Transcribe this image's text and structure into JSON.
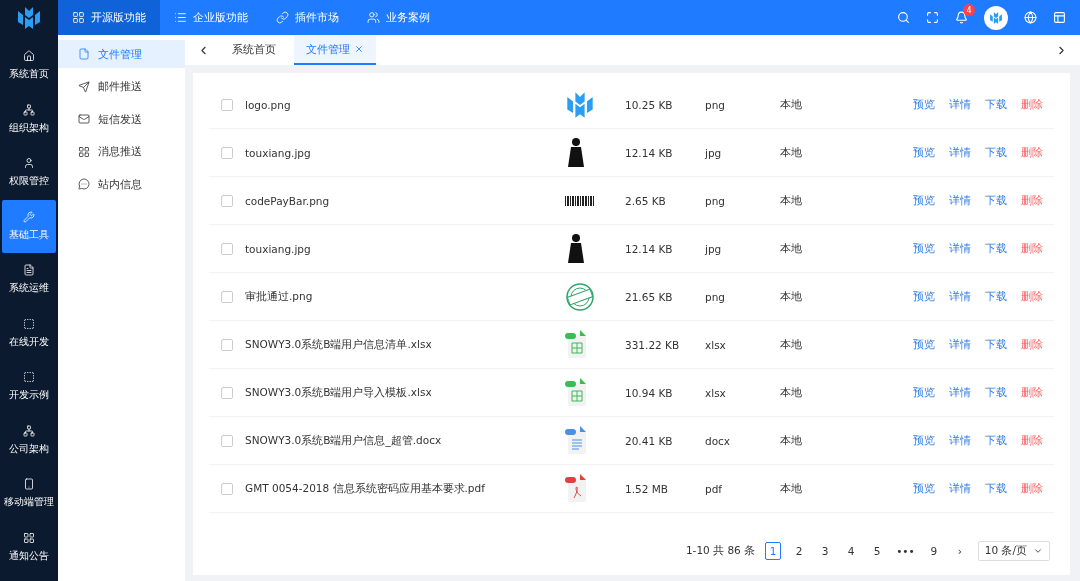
{
  "top_menu": [
    {
      "label": "开源版功能",
      "selected": true
    },
    {
      "label": "企业版功能",
      "selected": false
    },
    {
      "label": "插件市场",
      "selected": false
    },
    {
      "label": "业务案例",
      "selected": false
    }
  ],
  "notifications": {
    "count": "4"
  },
  "sidebar": {
    "items": [
      {
        "label": "系统首页",
        "selected": false
      },
      {
        "label": "组织架构",
        "selected": false
      },
      {
        "label": "权限管控",
        "selected": false
      },
      {
        "label": "基础工具",
        "selected": true
      },
      {
        "label": "系统运维",
        "selected": false
      },
      {
        "label": "在线开发",
        "selected": false
      },
      {
        "label": "开发示例",
        "selected": false
      },
      {
        "label": "公司架构",
        "selected": false
      },
      {
        "label": "移动端管理",
        "selected": false
      },
      {
        "label": "通知公告",
        "selected": false
      }
    ]
  },
  "submenu": {
    "items": [
      {
        "label": "文件管理",
        "selected": true
      },
      {
        "label": "邮件推送",
        "selected": false
      },
      {
        "label": "短信发送",
        "selected": false
      },
      {
        "label": "消息推送",
        "selected": false
      },
      {
        "label": "站内信息",
        "selected": false
      }
    ]
  },
  "tabs": [
    {
      "label": "系统首页",
      "selected": false,
      "closable": false
    },
    {
      "label": "文件管理",
      "selected": true,
      "closable": true
    }
  ],
  "table": {
    "rows": [
      {
        "name": "logo.png",
        "kind": "logo",
        "size": "10.25 KB",
        "type": "png",
        "storage": "本地",
        "checked": false,
        "actions": [
          {
            "label": "预览",
            "kind": "normal"
          },
          {
            "label": "详情",
            "kind": "normal"
          },
          {
            "label": "下载",
            "kind": "normal"
          },
          {
            "label": "删除",
            "kind": "danger"
          }
        ]
      },
      {
        "name": "touxiang.jpg",
        "kind": "figure",
        "size": "12.14 KB",
        "type": "jpg",
        "storage": "本地",
        "checked": false,
        "actions": [
          {
            "label": "预览",
            "kind": "normal"
          },
          {
            "label": "详情",
            "kind": "normal"
          },
          {
            "label": "下载",
            "kind": "normal"
          },
          {
            "label": "删除",
            "kind": "danger"
          }
        ]
      },
      {
        "name": "codePayBar.png",
        "kind": "barcode",
        "size": "2.65 KB",
        "type": "png",
        "storage": "本地",
        "checked": false,
        "actions": [
          {
            "label": "预览",
            "kind": "normal"
          },
          {
            "label": "详情",
            "kind": "normal"
          },
          {
            "label": "下载",
            "kind": "normal"
          },
          {
            "label": "删除",
            "kind": "danger"
          }
        ]
      },
      {
        "name": "touxiang.jpg",
        "kind": "figure",
        "size": "12.14 KB",
        "type": "jpg",
        "storage": "本地",
        "checked": false,
        "actions": [
          {
            "label": "预览",
            "kind": "normal"
          },
          {
            "label": "详情",
            "kind": "normal"
          },
          {
            "label": "下载",
            "kind": "normal"
          },
          {
            "label": "删除",
            "kind": "danger"
          }
        ]
      },
      {
        "name": "审批通过.png",
        "kind": "stamp",
        "size": "21.65 KB",
        "type": "png",
        "storage": "本地",
        "checked": false,
        "actions": [
          {
            "label": "预览",
            "kind": "normal"
          },
          {
            "label": "详情",
            "kind": "normal"
          },
          {
            "label": "下载",
            "kind": "normal"
          },
          {
            "label": "删除",
            "kind": "danger"
          }
        ]
      },
      {
        "name": "SNOWY3.0系统B端用户信息清单.xlsx",
        "kind": "sheet",
        "size": "331.22 KB",
        "type": "xlsx",
        "storage": "本地",
        "checked": false,
        "actions": [
          {
            "label": "预览",
            "kind": "normal"
          },
          {
            "label": "详情",
            "kind": "normal"
          },
          {
            "label": "下载",
            "kind": "normal"
          },
          {
            "label": "删除",
            "kind": "danger"
          }
        ]
      },
      {
        "name": "SNOWY3.0系统B端用户导入模板.xlsx",
        "kind": "sheet",
        "size": "10.94 KB",
        "type": "xlsx",
        "storage": "本地",
        "checked": false,
        "actions": [
          {
            "label": "预览",
            "kind": "normal"
          },
          {
            "label": "详情",
            "kind": "normal"
          },
          {
            "label": "下载",
            "kind": "normal"
          },
          {
            "label": "删除",
            "kind": "danger"
          }
        ]
      },
      {
        "name": "SNOWY3.0系统B端用户信息_超管.docx",
        "kind": "text",
        "size": "20.41 KB",
        "type": "docx",
        "storage": "本地",
        "checked": false,
        "actions": [
          {
            "label": "预览",
            "kind": "normal"
          },
          {
            "label": "详情",
            "kind": "normal"
          },
          {
            "label": "下载",
            "kind": "normal"
          },
          {
            "label": "删除",
            "kind": "danger"
          }
        ]
      },
      {
        "name": "GMT 0054-2018 信息系统密码应用基本要求.pdf",
        "kind": "acrobat",
        "size": "1.52 MB",
        "type": "pdf",
        "storage": "本地",
        "checked": false,
        "actions": [
          {
            "label": "预览",
            "kind": "normal"
          },
          {
            "label": "详情",
            "kind": "normal"
          },
          {
            "label": "下载",
            "kind": "normal"
          },
          {
            "label": "删除",
            "kind": "danger"
          }
        ]
      }
    ]
  },
  "pagination": {
    "total": "1-10 共 86 条",
    "pages": [
      {
        "label": "1",
        "selected": true
      },
      {
        "label": "2",
        "selected": false
      },
      {
        "label": "3",
        "selected": false
      },
      {
        "label": "4",
        "selected": false
      },
      {
        "label": "5",
        "selected": false
      },
      {
        "label": "•••",
        "selected": false
      },
      {
        "label": "9",
        "selected": false
      }
    ],
    "next": "›",
    "page_size": "10 条/页"
  }
}
